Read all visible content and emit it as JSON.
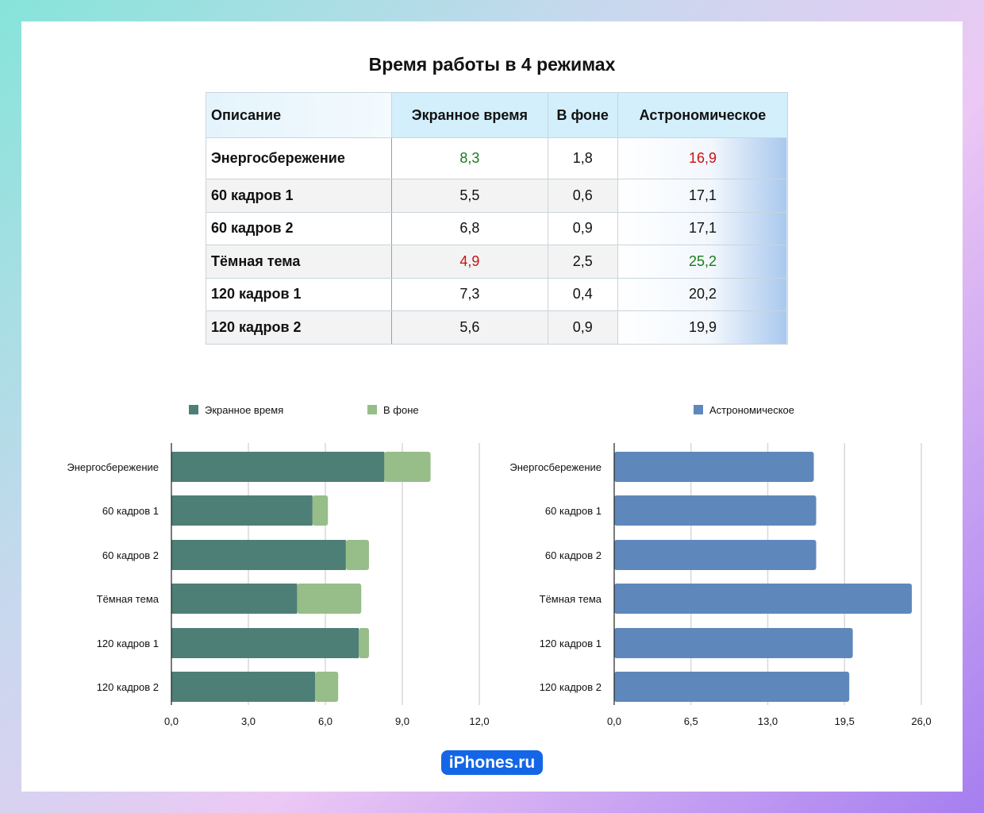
{
  "title": "Время работы в 4 режимах",
  "table": {
    "headers": [
      "Описание",
      "Экранное время",
      "В фоне",
      "Астрономическое"
    ],
    "rows": [
      [
        "Энергосбережение",
        "8,3",
        "1,8",
        "16,9"
      ],
      [
        "60 кадров 1",
        "5,5",
        "0,6",
        "17,1"
      ],
      [
        "60 кадров 2",
        "6,8",
        "0,9",
        "17,1"
      ],
      [
        "Тёмная тема",
        "4,9",
        "2,5",
        "25,2"
      ],
      [
        "120 кадров 1",
        "7,3",
        "0,4",
        "20,2"
      ],
      [
        "120 кадров 2",
        "5,6",
        "0,9",
        "19,9"
      ]
    ],
    "highlight": {
      "green": "#1d7a1d",
      "red": "#cc1111"
    }
  },
  "chart_data": [
    {
      "type": "bar",
      "orientation": "horizontal",
      "stacked": true,
      "categories": [
        "Энергосбережение",
        "60 кадров 1",
        "60 кадров 2",
        "Тёмная тема",
        "120 кадров 1",
        "120 кадров 2"
      ],
      "series": [
        {
          "name": "Экранное время",
          "values": [
            8.3,
            5.5,
            6.8,
            4.9,
            7.3,
            5.6
          ],
          "color": "#4e7f77"
        },
        {
          "name": "В фоне",
          "values": [
            1.8,
            0.6,
            0.9,
            2.5,
            0.4,
            0.9
          ],
          "color": "#97bd88"
        }
      ],
      "xlim": [
        0,
        12
      ],
      "xticks": [
        "0,0",
        "3,0",
        "6,0",
        "9,0",
        "12,0"
      ],
      "grid": true,
      "legend": "top"
    },
    {
      "type": "bar",
      "orientation": "horizontal",
      "categories": [
        "Энергосбережение",
        "60 кадров 1",
        "60 кадров 2",
        "Тёмная тема",
        "120 кадров 1",
        "120 кадров 2"
      ],
      "series": [
        {
          "name": "Астрономическое",
          "values": [
            16.9,
            17.1,
            17.1,
            25.2,
            20.2,
            19.9
          ],
          "color": "#5e88bc"
        }
      ],
      "xlim": [
        0,
        26
      ],
      "xticks": [
        "0,0",
        "6,5",
        "13,0",
        "19,5",
        "26,0"
      ],
      "grid": true,
      "legend": "top"
    }
  ],
  "logo": "iPhones.ru"
}
